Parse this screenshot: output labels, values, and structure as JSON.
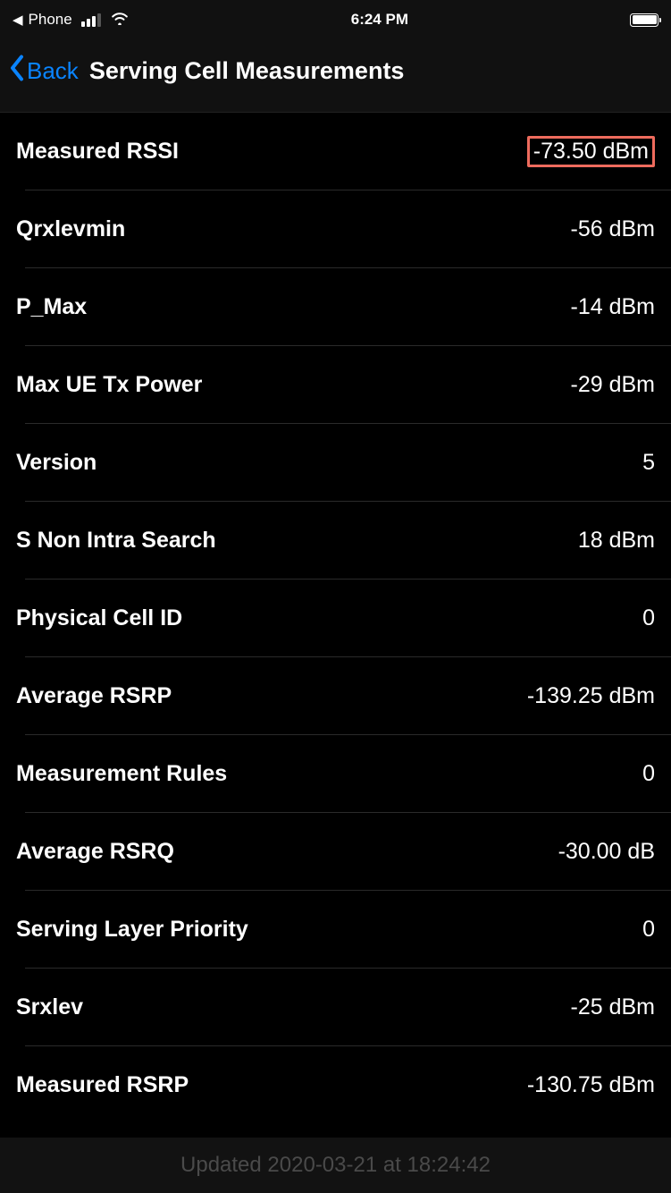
{
  "status": {
    "back_app_label": "Phone",
    "time": "6:24 PM"
  },
  "nav": {
    "back_label": "Back",
    "title": "Serving Cell Measurements"
  },
  "rows": [
    {
      "label": "Measured RSSI",
      "value": "-73.50 dBm",
      "highlighted": true
    },
    {
      "label": "Qrxlevmin",
      "value": "-56 dBm",
      "highlighted": false
    },
    {
      "label": "P_Max",
      "value": "-14 dBm",
      "highlighted": false
    },
    {
      "label": "Max UE Tx Power",
      "value": "-29 dBm",
      "highlighted": false
    },
    {
      "label": "Version",
      "value": "5",
      "highlighted": false
    },
    {
      "label": "S Non Intra Search",
      "value": "18 dBm",
      "highlighted": false
    },
    {
      "label": "Physical Cell ID",
      "value": "0",
      "highlighted": false
    },
    {
      "label": "Average RSRP",
      "value": "-139.25 dBm",
      "highlighted": false
    },
    {
      "label": "Measurement Rules",
      "value": "0",
      "highlighted": false
    },
    {
      "label": "Average RSRQ",
      "value": "-30.00 dB",
      "highlighted": false
    },
    {
      "label": "Serving Layer Priority",
      "value": "0",
      "highlighted": false
    },
    {
      "label": "Srxlev",
      "value": "-25 dBm",
      "highlighted": false
    },
    {
      "label": "Measured RSRP",
      "value": "-130.75 dBm",
      "highlighted": false
    }
  ],
  "footer": {
    "updated_text": "Updated 2020-03-21 at 18:24:42"
  }
}
